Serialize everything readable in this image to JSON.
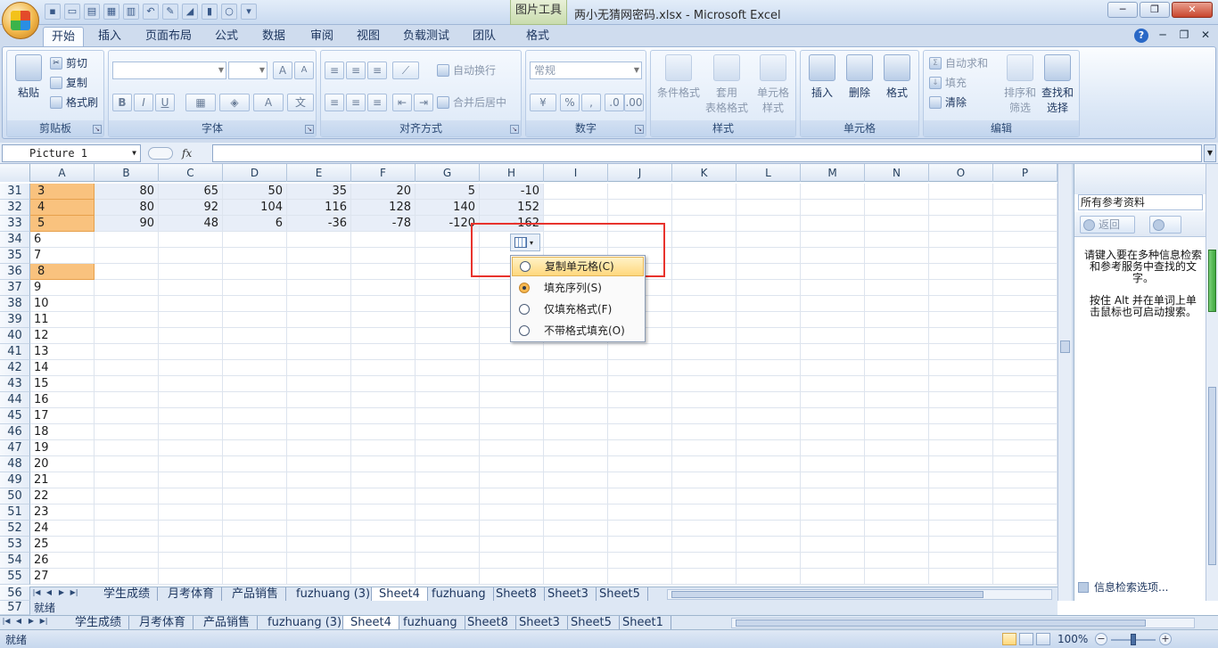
{
  "window": {
    "title": "两小无猜网密码.xlsx - Microsoft Excel",
    "context_tab_title": "图片工具",
    "controls": [
      "─",
      "❐",
      "✕"
    ]
  },
  "ribbon_tabs": [
    "开始",
    "插入",
    "页面布局",
    "公式",
    "数据",
    "审阅",
    "视图",
    "负载测试",
    "团队",
    "格式"
  ],
  "ribbon": {
    "clipboard": {
      "label": "剪贴板",
      "paste": "粘贴",
      "cut": "剪切",
      "copy": "复制",
      "format_painter": "格式刷"
    },
    "font": {
      "label": "字体",
      "bold": "B",
      "italic": "I",
      "underline": "U",
      "grow": "A",
      "shrink": "A"
    },
    "alignment": {
      "label": "对齐方式",
      "wrap_text": "自动换行",
      "merge_center": "合并后居中"
    },
    "number": {
      "label": "数字",
      "format": "常规",
      "percent": "%",
      "comma": ","
    },
    "styles": {
      "label": "样式",
      "conditional": "条件格式",
      "table_line1": "套用",
      "table_line2": "表格格式",
      "cell_line1": "单元格",
      "cell_line2": "样式"
    },
    "cells": {
      "label": "单元格",
      "insert": "插入",
      "delete": "删除",
      "format": "格式"
    },
    "editing": {
      "label": "编辑",
      "autosum": "自动求和",
      "fill": "填充",
      "clear": "清除",
      "sort_line1": "排序和",
      "sort_line2": "筛选",
      "find_line1": "查找和",
      "find_line2": "选择"
    }
  },
  "formula_bar": {
    "name_box": "Picture 1",
    "fx": "fx"
  },
  "columns": [
    "A",
    "B",
    "C",
    "D",
    "E",
    "F",
    "G",
    "H",
    "I",
    "J",
    "K",
    "L",
    "M",
    "N",
    "O",
    "P"
  ],
  "rows": [
    {
      "num": "31",
      "a": "3",
      "values": [
        "80",
        "65",
        "50",
        "35",
        "20",
        "5",
        "-10"
      ]
    },
    {
      "num": "32",
      "a": "4",
      "values": [
        "80",
        "92",
        "104",
        "116",
        "128",
        "140",
        "152"
      ]
    },
    {
      "num": "33",
      "a": "5",
      "values": [
        "90",
        "48",
        "6",
        "-36",
        "-78",
        "-120",
        "-162"
      ]
    },
    {
      "num": "34",
      "a": "6"
    },
    {
      "num": "35",
      "a": "7"
    },
    {
      "num": "36",
      "a": "8"
    },
    {
      "num": "37",
      "a": "9"
    },
    {
      "num": "38",
      "a": "10"
    },
    {
      "num": "39",
      "a": "11"
    },
    {
      "num": "40",
      "a": "12"
    },
    {
      "num": "41",
      "a": "13"
    },
    {
      "num": "42",
      "a": "14"
    },
    {
      "num": "43",
      "a": "15"
    },
    {
      "num": "44",
      "a": "16"
    },
    {
      "num": "45",
      "a": "17"
    },
    {
      "num": "46",
      "a": "18"
    },
    {
      "num": "47",
      "a": "19"
    },
    {
      "num": "48",
      "a": "20"
    },
    {
      "num": "49",
      "a": "21"
    },
    {
      "num": "50",
      "a": "22"
    },
    {
      "num": "51",
      "a": "23"
    },
    {
      "num": "52",
      "a": "24"
    },
    {
      "num": "53",
      "a": "25"
    },
    {
      "num": "54",
      "a": "26"
    },
    {
      "num": "55",
      "a": "27"
    }
  ],
  "extra_rows": {
    "r56": "56",
    "r57": "57"
  },
  "autofill_menu": {
    "options": [
      {
        "label": "复制单元格(C)",
        "checked": false
      },
      {
        "label": "填充序列(S)",
        "checked": true
      },
      {
        "label": "仅填充格式(F)",
        "checked": false
      },
      {
        "label": "不带格式填充(O)",
        "checked": false
      }
    ]
  },
  "research": {
    "scope": "所有参考资料",
    "back": "返回",
    "text1_line1": "请键入要在多种信息检索",
    "text1_line2": "和参考服务中查找的文",
    "text1_line3": "字。",
    "text2_line1": "按住 Alt 并在单词上单",
    "text2_line2": "击鼠标也可启动搜索。",
    "options": "信息检索选项..."
  },
  "sheet_tabs_inner": [
    "学生成绩",
    "月考体育",
    "产品销售",
    "fuzhuang (3)",
    "Sheet4",
    "fuzhuang",
    "Sheet8",
    "Sheet3",
    "Sheet5"
  ],
  "sheet_tabs_outer": [
    "学生成绩",
    "月考体育",
    "产品销售",
    "fuzhuang (3)",
    "Sheet4",
    "fuzhuang",
    "Sheet8",
    "Sheet3",
    "Sheet5",
    "Sheet1"
  ],
  "status": {
    "text": "就绪",
    "inner_text": "就绪",
    "zoom": "100%"
  },
  "colors": {
    "accent": "#e8332d",
    "orange_cell": "#f9c27e"
  }
}
